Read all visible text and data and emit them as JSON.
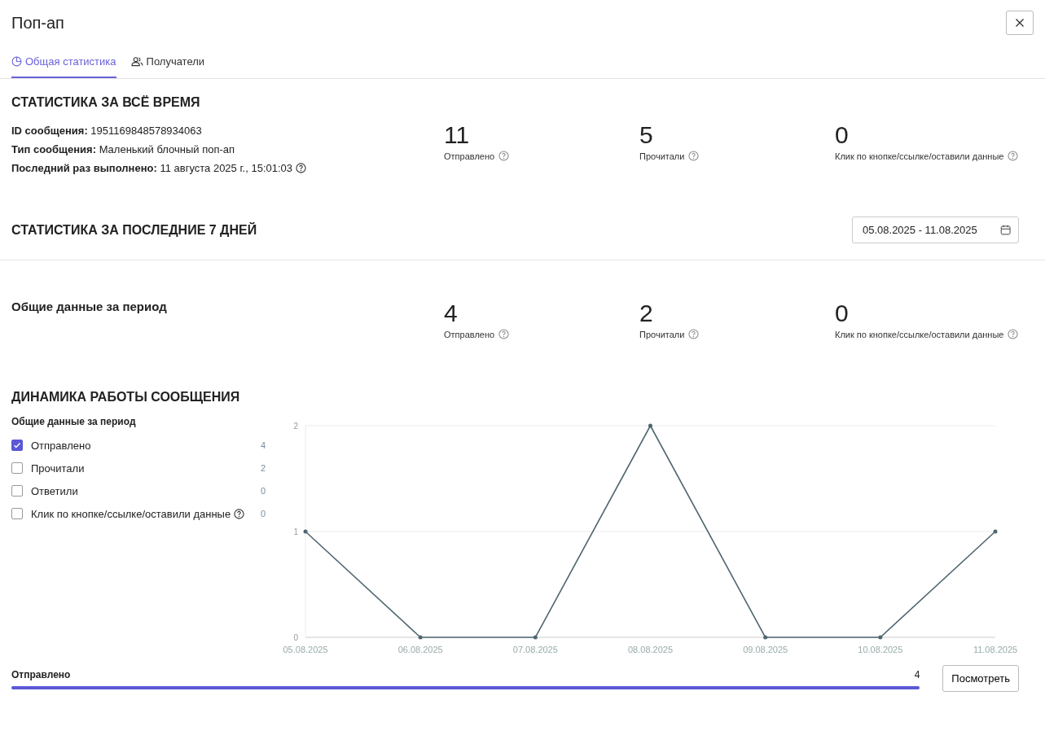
{
  "title": "Поп-ап",
  "tabs": [
    {
      "label": "Общая статистика",
      "selected": true
    },
    {
      "label": "Получатели",
      "selected": false
    }
  ],
  "all_time": {
    "heading": "СТАТИСТИКА ЗА ВСЁ ВРЕМЯ",
    "info": [
      {
        "label": "ID сообщения:",
        "value": "1951169848578934063",
        "help": false
      },
      {
        "label": "Тип сообщения:",
        "value": "Маленький блочный поп-ап",
        "help": false
      },
      {
        "label": "Последний раз выполнено:",
        "value": "11 августа 2025 г., 15:01:03",
        "help": true
      }
    ],
    "stats": [
      {
        "value": "11",
        "label": "Отправлено"
      },
      {
        "value": "5",
        "label": "Прочитали"
      },
      {
        "value": "0",
        "label": "Клик по кнопке/ссылке/оставили данные"
      }
    ]
  },
  "last_7_days": {
    "heading": "СТАТИСТИКА ЗА ПОСЛЕДНИЕ 7 ДНЕЙ",
    "date_range": "05.08.2025 - 11.08.2025",
    "period_title": "Общие данные за период",
    "stats": [
      {
        "value": "4",
        "label": "Отправлено"
      },
      {
        "value": "2",
        "label": "Прочитали"
      },
      {
        "value": "0",
        "label": "Клик по кнопке/ссылке/оставили данные"
      }
    ]
  },
  "dynamics": {
    "heading": "ДИНАМИКА РАБОТЫ СООБЩЕНИЯ",
    "legend_title": "Общие данные за период",
    "metrics": [
      {
        "label": "Отправлено",
        "count": "4",
        "checked": true,
        "help": false
      },
      {
        "label": "Прочитали",
        "count": "2",
        "checked": false,
        "help": false
      },
      {
        "label": "Ответили",
        "count": "0",
        "checked": false,
        "help": false
      },
      {
        "label": "Клик по кнопке/ссылке/оставили данные",
        "count": "0",
        "checked": false,
        "help": true
      }
    ],
    "chart_data": {
      "type": "line",
      "categories": [
        "05.08.2025",
        "06.08.2025",
        "07.08.2025",
        "08.08.2025",
        "09.08.2025",
        "10.08.2025",
        "11.08.2025"
      ],
      "series": [
        {
          "color": "#4f6670",
          "values": [
            1,
            0,
            0,
            2,
            0,
            0,
            1
          ]
        }
      ],
      "ylim": [
        0,
        2
      ],
      "yticks": [
        0,
        1,
        2
      ]
    },
    "summary": {
      "label": "Отправлено",
      "value": "4",
      "level": 1
    },
    "view_button": "Посмотреть"
  }
}
